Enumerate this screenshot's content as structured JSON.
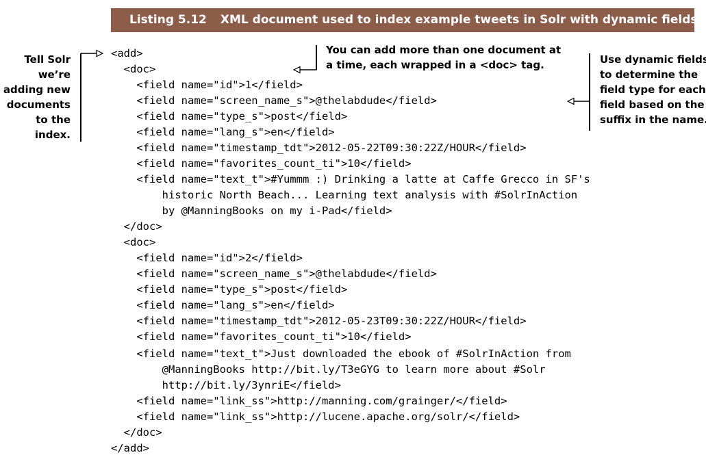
{
  "listing": {
    "number": "Listing 5.12",
    "title": "XML document used to index example tweets in Solr with dynamic fields"
  },
  "code_lines": [
    "<add>",
    "  <doc>",
    "    <field name=\"id\">1</field>",
    "    <field name=\"screen_name_s\">@thelabdude</field>",
    "    <field name=\"type_s\">post</field>",
    "    <field name=\"lang_s\">en</field>",
    "    <field name=\"timestamp_tdt\">2012-05-22T09:30:22Z/HOUR</field>",
    "    <field name=\"favorites_count_ti\">10</field>",
    "    <field name=\"text_t\">#Yummm :) Drinking a latte at Caffe Grecco in SF's",
    "        historic North Beach... Learning text analysis with #SolrInAction",
    "        by @ManningBooks on my i-Pad</field>",
    "  </doc>",
    "  <doc>",
    "    <field name=\"id\">2</field>",
    "    <field name=\"screen_name_s\">@thelabdude</field>",
    "    <field name=\"type_s\">post</field>",
    "    <field name=\"lang_s\">en</field>",
    "    <field name=\"timestamp_tdt\">2012-05-23T09:30:22Z/HOUR</field>",
    "    <field name=\"favorites_count_ti\">10</field>",
    "    <field name=\"text_t\">Just downloaded the ebook of #SolrInAction from",
    "        @ManningBooks http://bit.ly/T3eGYG to learn more about #Solr",
    "        http://bit.ly/3ynriE</field>",
    "    <field name=\"link_ss\">http://manning.com/grainger/</field>",
    "    <field name=\"link_ss\">http://lucene.apache.org/solr/</field>",
    "  </doc>",
    "</add>"
  ],
  "annotations": {
    "left": [
      "Tell Solr",
      "we’re",
      "adding new",
      "documents",
      "to the",
      "index."
    ],
    "top": [
      "You can add more than one document at",
      "a time, each wrapped in a <doc> tag."
    ],
    "right": [
      "Use dynamic fields",
      "to determine the",
      "field type for each",
      "field based on the",
      "suffix in the name."
    ]
  }
}
